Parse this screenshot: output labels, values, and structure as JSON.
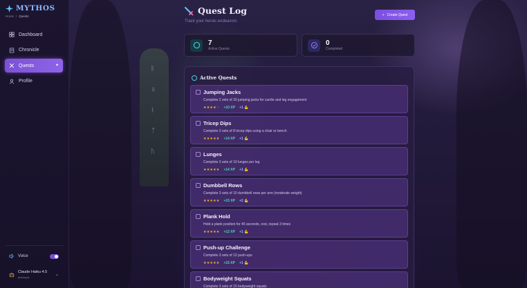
{
  "brand": {
    "title": "MYTHOS"
  },
  "breadcrumb": {
    "home": "Home",
    "sep": "/",
    "current": "Quests"
  },
  "nav": {
    "dashboard": "Dashboard",
    "chronicle": "Chronicle",
    "quests": "Quests",
    "profile": "Profile"
  },
  "voice": {
    "label": "Voice",
    "enabled": true
  },
  "model": {
    "name": "Claude Haiku 4.5",
    "provider": "anthropic"
  },
  "header": {
    "title": "Quest Log",
    "subtitle": "Track your heroic endeavors",
    "create_label": "Create Quest"
  },
  "stats": {
    "active": {
      "value": "7",
      "label": "Active Quests"
    },
    "completed": {
      "value": "0",
      "label": "Completed"
    }
  },
  "panel": {
    "title": "Active Quests"
  },
  "quests": [
    {
      "title": "Jumping Jacks",
      "desc": "Complete 2 sets of 20 jumping jacks for cardio and leg engagement",
      "stars": 4,
      "xp": "+10 XP",
      "bonus": "+1"
    },
    {
      "title": "Tricep Dips",
      "desc": "Complete 3 sets of 8 tricep dips using a chair or bench",
      "stars": 5,
      "xp": "+14 XP",
      "bonus": "+1"
    },
    {
      "title": "Lunges",
      "desc": "Complete 3 sets of 10 lunges per leg",
      "stars": 5,
      "xp": "+14 XP",
      "bonus": "+1"
    },
    {
      "title": "Dumbbell Rows",
      "desc": "Complete 3 sets of 10 dumbbell rows per arm (moderate weight)",
      "stars": 5,
      "xp": "+15 XP",
      "bonus": "+2"
    },
    {
      "title": "Plank Hold",
      "desc": "Hold a plank position for 45 seconds, rest, repeat 3 times",
      "stars": 5,
      "xp": "+12 XP",
      "bonus": "+1"
    },
    {
      "title": "Push-up Challenge",
      "desc": "Complete 3 sets of 12 push-ups",
      "stars": 5,
      "xp": "+15 XP",
      "bonus": "+1"
    },
    {
      "title": "Bodyweight Squats",
      "desc": "Complete 3 sets of 15 bodyweight squats",
      "stars": 5,
      "xp": "+12 XP",
      "bonus": "+1"
    }
  ],
  "colors": {
    "accent": "#8c5ff0",
    "xp": "#49d6b4",
    "star": "#f5b82e",
    "brand": "#8fb8ff"
  },
  "icons": {
    "brand": "sparkle-icon",
    "dashboard": "dashboard-icon",
    "chronicle": "scroll-icon",
    "quests": "crossed-swords-icon",
    "profile": "user-icon",
    "voice": "speaker-icon",
    "model": "robot-icon",
    "title": "sword-icon",
    "active": "target-icon",
    "completed": "check-circle-icon"
  }
}
